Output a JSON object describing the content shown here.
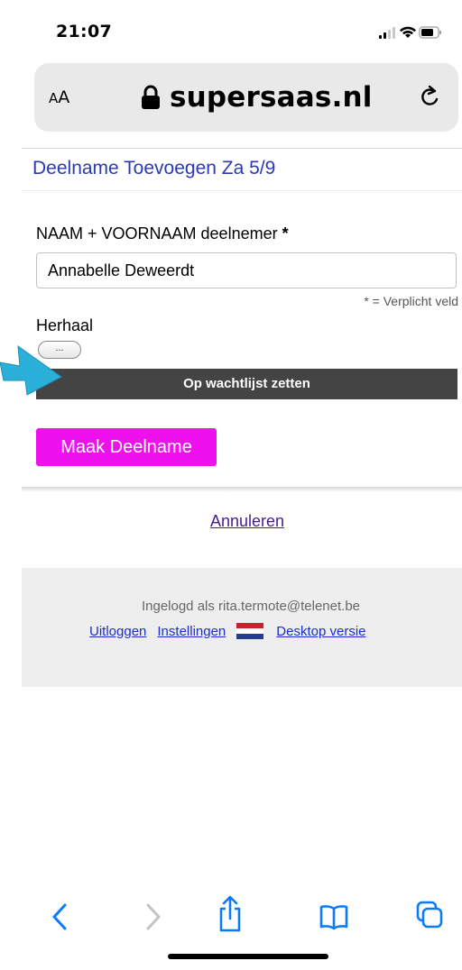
{
  "status_bar": {
    "time": "21:07",
    "icons": [
      "signal-icon",
      "wifi-icon",
      "battery-icon"
    ]
  },
  "url_bar": {
    "aa_label_small": "A",
    "aa_label_large": "A",
    "domain": "supersaas.nl",
    "icons": [
      "lock-icon",
      "reload-icon"
    ]
  },
  "page": {
    "title": "Deelname Toevoegen Za 5/9",
    "name_field": {
      "label": "NAAM + VOORNAAM deelnemer",
      "required_marker": "*",
      "value": "Annabelle Deweerdt"
    },
    "required_note": "* = Verplicht veld",
    "repeat": {
      "label": "Herhaal",
      "button": "..."
    },
    "waitlist_label": "Op wachtlijst zetten",
    "submit_label": "Maak Deelname",
    "cancel_label": "Annuleren"
  },
  "footer": {
    "logged_in_text": "Ingelogd als rita.termote@telenet.be",
    "links": {
      "logout": "Uitloggen",
      "settings": "Instellingen",
      "desktop": "Desktop versie"
    },
    "flag": "netherlands-flag-icon"
  },
  "toolbar": {
    "icons": [
      "back-icon",
      "forward-icon",
      "share-icon",
      "bookmarks-icon",
      "tabs-icon"
    ]
  },
  "colors": {
    "title_blue": "#2a39b6",
    "submit_magenta": "#ee11ee",
    "waitlist_dark": "#444444",
    "link_blue": "#1a2ed0",
    "ios_blue": "#0a7aff",
    "arrow_cyan": "#2ab0d9"
  }
}
